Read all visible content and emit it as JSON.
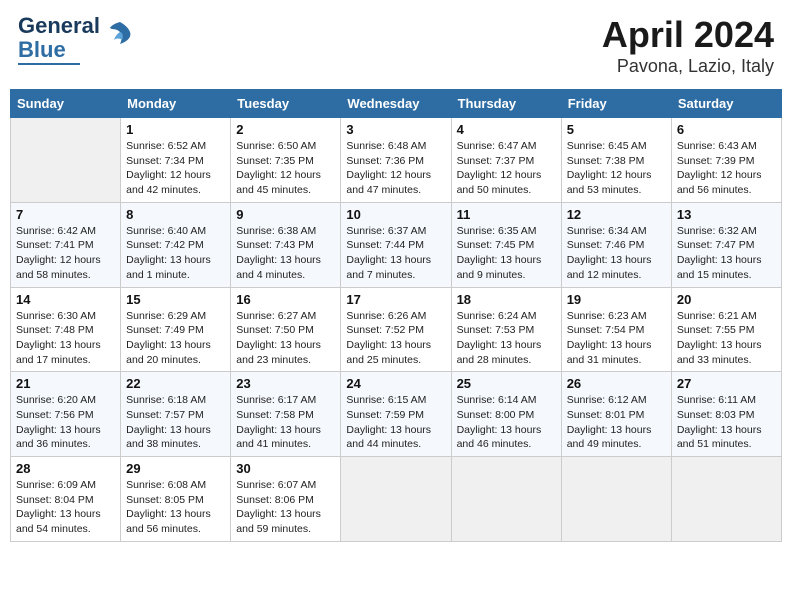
{
  "header": {
    "logo_line1": "General",
    "logo_line2": "Blue",
    "title": "April 2024",
    "subtitle": "Pavona, Lazio, Italy"
  },
  "days_of_week": [
    "Sunday",
    "Monday",
    "Tuesday",
    "Wednesday",
    "Thursday",
    "Friday",
    "Saturday"
  ],
  "weeks": [
    [
      {
        "day": "",
        "info": ""
      },
      {
        "day": "1",
        "info": "Sunrise: 6:52 AM\nSunset: 7:34 PM\nDaylight: 12 hours\nand 42 minutes."
      },
      {
        "day": "2",
        "info": "Sunrise: 6:50 AM\nSunset: 7:35 PM\nDaylight: 12 hours\nand 45 minutes."
      },
      {
        "day": "3",
        "info": "Sunrise: 6:48 AM\nSunset: 7:36 PM\nDaylight: 12 hours\nand 47 minutes."
      },
      {
        "day": "4",
        "info": "Sunrise: 6:47 AM\nSunset: 7:37 PM\nDaylight: 12 hours\nand 50 minutes."
      },
      {
        "day": "5",
        "info": "Sunrise: 6:45 AM\nSunset: 7:38 PM\nDaylight: 12 hours\nand 53 minutes."
      },
      {
        "day": "6",
        "info": "Sunrise: 6:43 AM\nSunset: 7:39 PM\nDaylight: 12 hours\nand 56 minutes."
      }
    ],
    [
      {
        "day": "7",
        "info": "Sunrise: 6:42 AM\nSunset: 7:41 PM\nDaylight: 12 hours\nand 58 minutes."
      },
      {
        "day": "8",
        "info": "Sunrise: 6:40 AM\nSunset: 7:42 PM\nDaylight: 13 hours\nand 1 minute."
      },
      {
        "day": "9",
        "info": "Sunrise: 6:38 AM\nSunset: 7:43 PM\nDaylight: 13 hours\nand 4 minutes."
      },
      {
        "day": "10",
        "info": "Sunrise: 6:37 AM\nSunset: 7:44 PM\nDaylight: 13 hours\nand 7 minutes."
      },
      {
        "day": "11",
        "info": "Sunrise: 6:35 AM\nSunset: 7:45 PM\nDaylight: 13 hours\nand 9 minutes."
      },
      {
        "day": "12",
        "info": "Sunrise: 6:34 AM\nSunset: 7:46 PM\nDaylight: 13 hours\nand 12 minutes."
      },
      {
        "day": "13",
        "info": "Sunrise: 6:32 AM\nSunset: 7:47 PM\nDaylight: 13 hours\nand 15 minutes."
      }
    ],
    [
      {
        "day": "14",
        "info": "Sunrise: 6:30 AM\nSunset: 7:48 PM\nDaylight: 13 hours\nand 17 minutes."
      },
      {
        "day": "15",
        "info": "Sunrise: 6:29 AM\nSunset: 7:49 PM\nDaylight: 13 hours\nand 20 minutes."
      },
      {
        "day": "16",
        "info": "Sunrise: 6:27 AM\nSunset: 7:50 PM\nDaylight: 13 hours\nand 23 minutes."
      },
      {
        "day": "17",
        "info": "Sunrise: 6:26 AM\nSunset: 7:52 PM\nDaylight: 13 hours\nand 25 minutes."
      },
      {
        "day": "18",
        "info": "Sunrise: 6:24 AM\nSunset: 7:53 PM\nDaylight: 13 hours\nand 28 minutes."
      },
      {
        "day": "19",
        "info": "Sunrise: 6:23 AM\nSunset: 7:54 PM\nDaylight: 13 hours\nand 31 minutes."
      },
      {
        "day": "20",
        "info": "Sunrise: 6:21 AM\nSunset: 7:55 PM\nDaylight: 13 hours\nand 33 minutes."
      }
    ],
    [
      {
        "day": "21",
        "info": "Sunrise: 6:20 AM\nSunset: 7:56 PM\nDaylight: 13 hours\nand 36 minutes."
      },
      {
        "day": "22",
        "info": "Sunrise: 6:18 AM\nSunset: 7:57 PM\nDaylight: 13 hours\nand 38 minutes."
      },
      {
        "day": "23",
        "info": "Sunrise: 6:17 AM\nSunset: 7:58 PM\nDaylight: 13 hours\nand 41 minutes."
      },
      {
        "day": "24",
        "info": "Sunrise: 6:15 AM\nSunset: 7:59 PM\nDaylight: 13 hours\nand 44 minutes."
      },
      {
        "day": "25",
        "info": "Sunrise: 6:14 AM\nSunset: 8:00 PM\nDaylight: 13 hours\nand 46 minutes."
      },
      {
        "day": "26",
        "info": "Sunrise: 6:12 AM\nSunset: 8:01 PM\nDaylight: 13 hours\nand 49 minutes."
      },
      {
        "day": "27",
        "info": "Sunrise: 6:11 AM\nSunset: 8:03 PM\nDaylight: 13 hours\nand 51 minutes."
      }
    ],
    [
      {
        "day": "28",
        "info": "Sunrise: 6:09 AM\nSunset: 8:04 PM\nDaylight: 13 hours\nand 54 minutes."
      },
      {
        "day": "29",
        "info": "Sunrise: 6:08 AM\nSunset: 8:05 PM\nDaylight: 13 hours\nand 56 minutes."
      },
      {
        "day": "30",
        "info": "Sunrise: 6:07 AM\nSunset: 8:06 PM\nDaylight: 13 hours\nand 59 minutes."
      },
      {
        "day": "",
        "info": ""
      },
      {
        "day": "",
        "info": ""
      },
      {
        "day": "",
        "info": ""
      },
      {
        "day": "",
        "info": ""
      }
    ]
  ]
}
